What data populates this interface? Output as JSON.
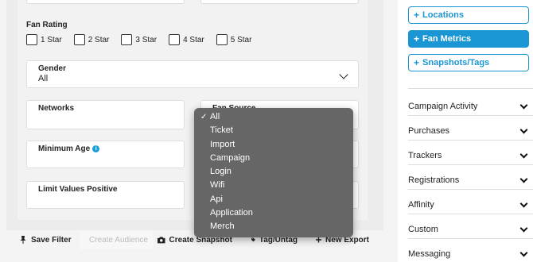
{
  "filters": {
    "fan_rating": {
      "label": "Fan Rating",
      "options": [
        "1 Star",
        "2 Star",
        "3 Star",
        "4 Star",
        "5 Star"
      ]
    },
    "gender": {
      "label": "Gender",
      "value": "All"
    },
    "networks": {
      "label": "Networks",
      "value": ""
    },
    "fan_source": {
      "label": "Fan Source",
      "value": "All"
    },
    "minimum_age": {
      "label": "Minimum Age"
    },
    "limit_values_positive": {
      "label": "Limit Values Positive"
    }
  },
  "fan_source_menu": {
    "selected": "All",
    "options": [
      "All",
      "Ticket",
      "Import",
      "Campaign",
      "Login",
      "Wifi",
      "Api",
      "Application",
      "Merch"
    ]
  },
  "toolbar": {
    "save_filter": "Save Filter",
    "create_audience": "Create Audience",
    "create_snapshot": "Create Snapshot",
    "tag_untag": "Tag/Untag",
    "new_export": "New Export"
  },
  "sidebar": {
    "buttons": [
      {
        "label": "Locations",
        "active": false
      },
      {
        "label": "Fan Metrics",
        "active": true
      },
      {
        "label": "Snapshots/Tags",
        "active": false
      }
    ],
    "sections": [
      "Campaign Activity",
      "Purchases",
      "Trackers",
      "Registrations",
      "Affinity",
      "Custom",
      "Messaging"
    ]
  },
  "colors": {
    "accent": "#1b96d4",
    "menu_bg": "#666666",
    "info": "#1aa0d8"
  }
}
